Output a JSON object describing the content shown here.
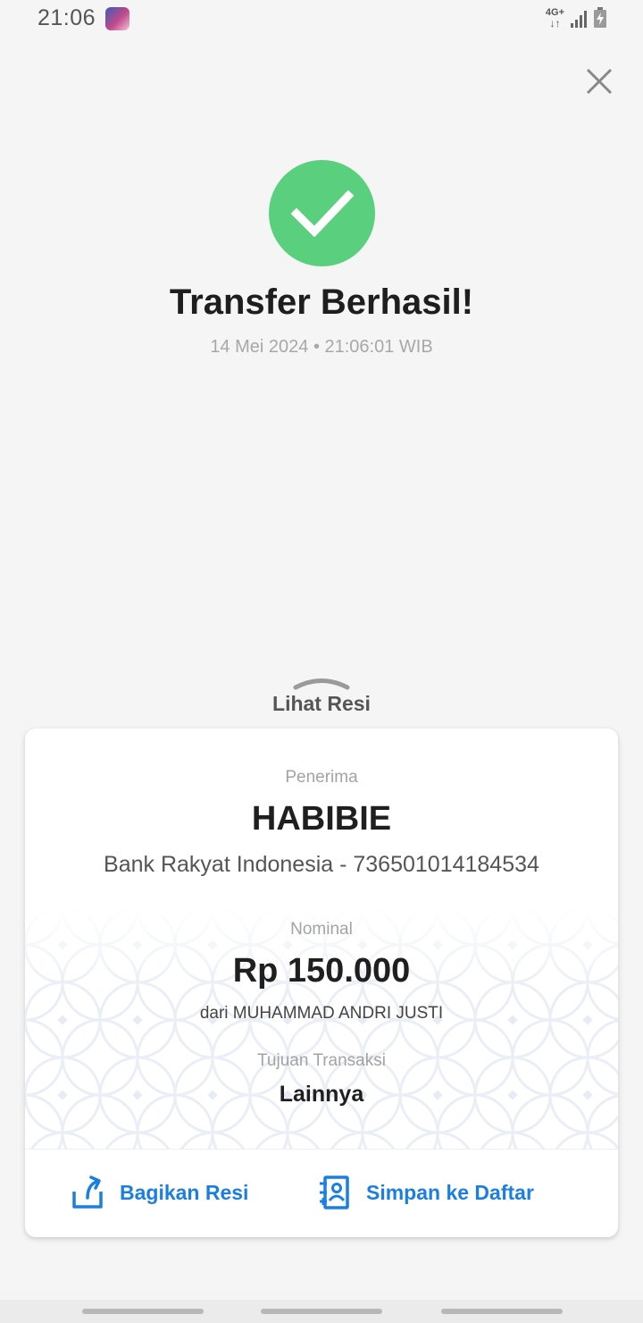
{
  "status_bar": {
    "time": "21:06",
    "network": "4G+",
    "network_arrows": "↓↑",
    "icons": [
      "app-icon",
      "signal-icon",
      "battery-charging-icon"
    ]
  },
  "header": {
    "close_icon": "close-icon"
  },
  "success": {
    "icon": "check-circle-icon",
    "icon_color": "#5ad07f",
    "title": "Transfer Berhasil!",
    "timestamp": "14 Mei 2024 • 21:06:01 WIB"
  },
  "receipt_toggle": {
    "label": "Lihat Resi",
    "icon": "chevron-up-icon"
  },
  "receipt": {
    "recipient_label": "Penerima",
    "recipient_name": "HABIBIE",
    "recipient_bank": "Bank Rakyat Indonesia - 736501014184534",
    "amount_label": "Nominal",
    "amount": "Rp 150.000",
    "sender": "dari MUHAMMAD ANDRI JUSTI",
    "purpose_label": "Tujuan Transaksi",
    "purpose": "Lainnya"
  },
  "actions": {
    "share_label": "Bagikan Resi",
    "share_icon": "share-icon",
    "save_label": "Simpan ke Daftar",
    "save_icon": "contact-book-add-icon",
    "accent_color": "#1a7fe0"
  }
}
